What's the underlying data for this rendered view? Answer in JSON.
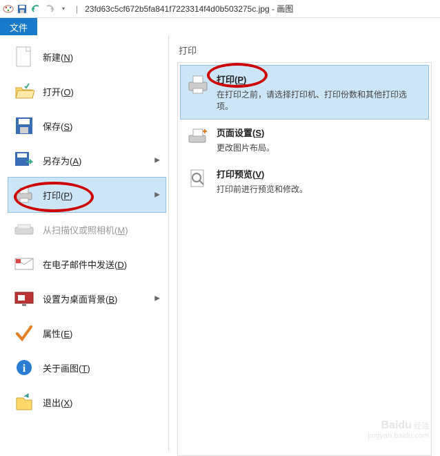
{
  "titlebar": {
    "filename": "23fd63c5cf672b5fa841f7223314f4d0b503275c.jpg",
    "app_name": "画图"
  },
  "tabs": {
    "file": "文件"
  },
  "menu": {
    "new": {
      "label": "新建",
      "key": "N"
    },
    "open": {
      "label": "打开",
      "key": "O"
    },
    "save": {
      "label": "保存",
      "key": "S"
    },
    "saveas": {
      "label": "另存为",
      "key": "A"
    },
    "print": {
      "label": "打印",
      "key": "P"
    },
    "scanner": {
      "label": "从扫描仪或照相机",
      "key": "M"
    },
    "email": {
      "label": "在电子邮件中发送",
      "key": "D"
    },
    "desktop": {
      "label": "设置为桌面背景",
      "key": "B"
    },
    "props": {
      "label": "属性",
      "key": "E"
    },
    "about": {
      "label": "关于画图",
      "key": "T"
    },
    "exit": {
      "label": "退出",
      "key": "X"
    }
  },
  "submenu": {
    "title": "打印",
    "print": {
      "title": "打印",
      "key": "P",
      "desc": "在打印之前，请选择打印机、打印份数和其他打印选项。"
    },
    "pagesetup": {
      "title": "页面设置",
      "key": "S",
      "desc": "更改图片布局。"
    },
    "preview": {
      "title": "打印预览",
      "key": "V",
      "desc": "打印前进行预览和修改。"
    }
  },
  "watermark": {
    "brand": "Baidu",
    "sub": "经验"
  }
}
